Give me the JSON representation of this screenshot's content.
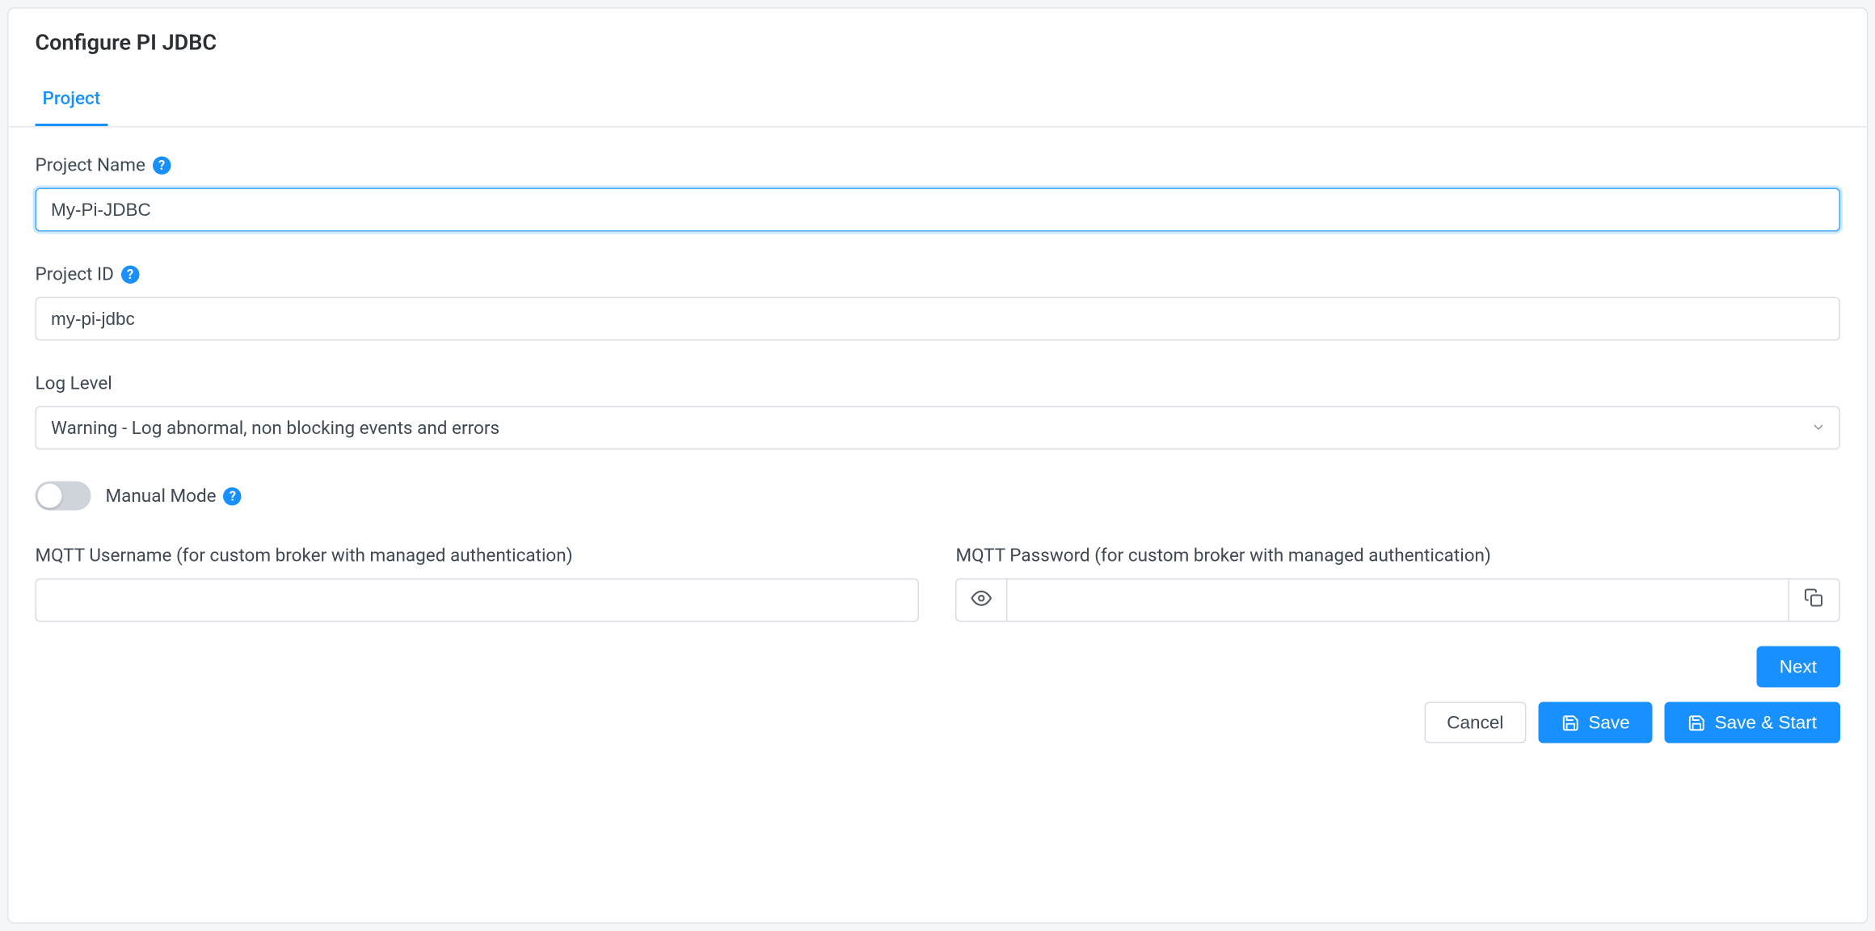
{
  "header": {
    "title": "Configure PI JDBC"
  },
  "tabs": [
    {
      "label": "Project",
      "active": true
    }
  ],
  "fields": {
    "project_name": {
      "label": "Project Name",
      "value": "My-Pi-JDBC",
      "help": true
    },
    "project_id": {
      "label": "Project ID",
      "value": "my-pi-jdbc",
      "help": true
    },
    "log_level": {
      "label": "Log Level",
      "value": "Warning - Log abnormal, non blocking events and errors"
    },
    "manual_mode": {
      "label": "Manual Mode",
      "value": false,
      "help": true
    },
    "mqtt_username": {
      "label": "MQTT Username (for custom broker with managed authentication)",
      "value": ""
    },
    "mqtt_password": {
      "label": "MQTT Password (for custom broker with managed authentication)",
      "value": ""
    }
  },
  "buttons": {
    "next": "Next",
    "cancel": "Cancel",
    "save": "Save",
    "save_start": "Save & Start"
  }
}
